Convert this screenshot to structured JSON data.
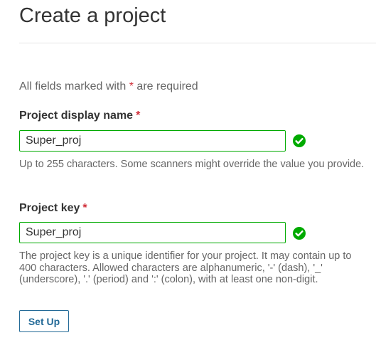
{
  "page": {
    "title": "Create a project"
  },
  "form": {
    "required_note_prefix": "All fields marked with",
    "required_marker": "*",
    "required_note_suffix": "are required",
    "display_name": {
      "label": "Project display name",
      "value": "Super_proj",
      "status_icon": "check-circle-icon",
      "help": "Up to 255 characters. Some scanners might override the value you provide."
    },
    "project_key": {
      "label": "Project key",
      "value": "Super_proj",
      "status_icon": "check-circle-icon",
      "help": "The project key is a unique identifier for your project. It may contain up to 400 characters. Allowed characters are alphanumeric, '-' (dash), '_' (underscore), '.' (period) and ':' (colon), with at least one non-digit."
    },
    "submit_label": "Set Up"
  },
  "colors": {
    "required": "#d02f3a",
    "valid": "#00aa00",
    "button": "#236a97",
    "text": "#333333",
    "muted": "#666666"
  }
}
